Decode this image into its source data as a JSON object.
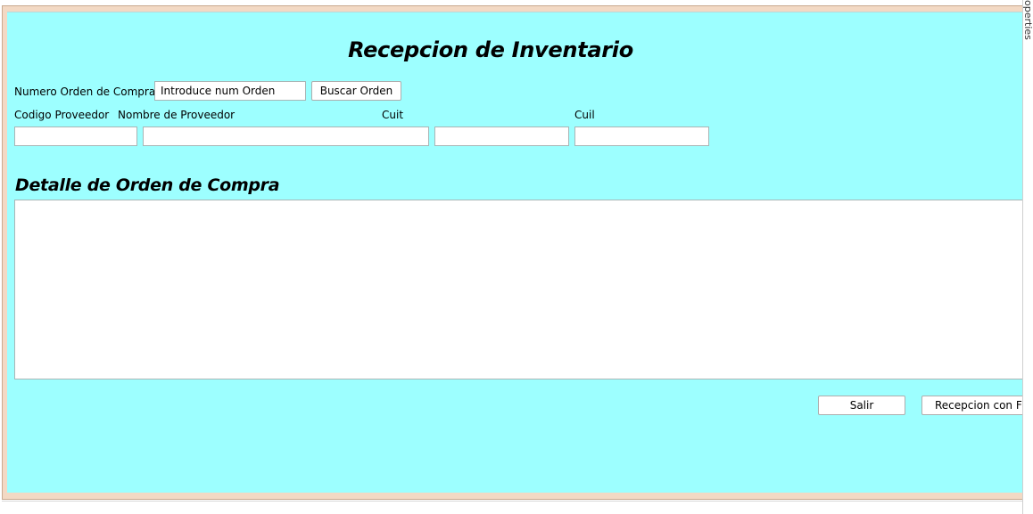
{
  "form": {
    "title": "Recepcion de Inventario",
    "order_number_label": "Numero Orden de Compra:",
    "order_number_value": "Introduce num Orden",
    "search_button_label": "Buscar Orden",
    "supplier_code_label": "Codigo Proveedor",
    "supplier_name_label": "Nombre de Proveedor",
    "cuit_label": "Cuit",
    "cuil_label": "Cuil",
    "supplier_code_value": "",
    "supplier_name_value": "",
    "cuit_value": "",
    "cuil_value": "",
    "detail_title": "Detalle de Orden de Compra",
    "exit_button_label": "Salir",
    "sign_button_label": "Recepcion con Firm"
  },
  "side_panel": {
    "label": "operties"
  },
  "colors": {
    "form_background": "#9dffff",
    "frame_border": "#f3d9c4"
  }
}
